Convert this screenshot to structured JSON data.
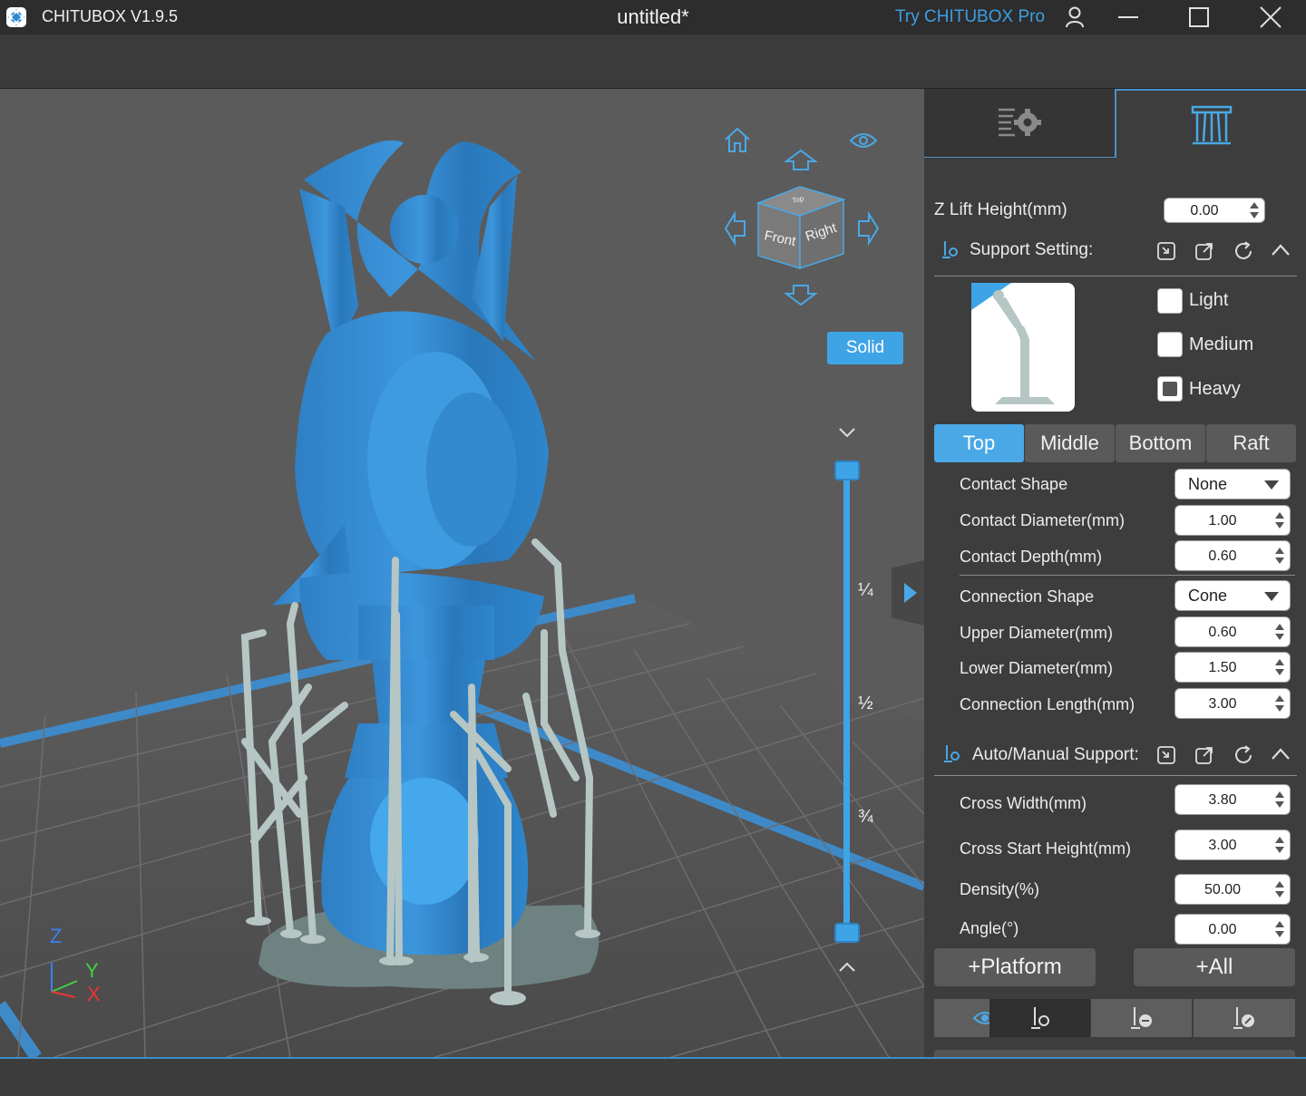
{
  "titlebar": {
    "app_name": "CHITUBOX V1.9.5",
    "document_title": "untitled*",
    "pro_link": "Try CHITUBOX Pro"
  },
  "viewport": {
    "cube_faces": {
      "front": "Front",
      "right": "Right",
      "top": "Top"
    },
    "render_mode": "Solid",
    "slider_marks": [
      "¼",
      "½",
      "¾"
    ],
    "axes": {
      "z": "Z",
      "y": "Y",
      "x": "X"
    }
  },
  "panel": {
    "z_lift_label": "Z Lift Height(mm)",
    "z_lift_value": "0.00",
    "support_setting": {
      "title": "Support Setting:",
      "presets": [
        {
          "label": "Light",
          "checked": false
        },
        {
          "label": "Medium",
          "checked": false
        },
        {
          "label": "Heavy",
          "checked": true
        }
      ]
    },
    "tabs": [
      {
        "label": "Top",
        "active": true
      },
      {
        "label": "Middle",
        "active": false
      },
      {
        "label": "Bottom",
        "active": false
      },
      {
        "label": "Raft",
        "active": false
      }
    ],
    "contact": {
      "shape_label": "Contact Shape",
      "shape_value": "None",
      "diameter_label": "Contact Diameter(mm)",
      "diameter_value": "1.00",
      "depth_label": "Contact Depth(mm)",
      "depth_value": "0.60"
    },
    "connection": {
      "shape_label": "Connection Shape",
      "shape_value": "Cone",
      "upper_label": "Upper Diameter(mm)",
      "upper_value": "0.60",
      "lower_label": "Lower Diameter(mm)",
      "lower_value": "1.50",
      "length_label": "Connection Length(mm)",
      "length_value": "3.00"
    },
    "auto_manual": {
      "title": "Auto/Manual Support:",
      "cross_width_label": "Cross Width(mm)",
      "cross_width_value": "3.80",
      "cross_start_label": "Cross Start Height(mm)",
      "cross_start_value": "3.00",
      "density_label": "Density(%)",
      "density_value": "50.00",
      "angle_label": "Angle(°)",
      "angle_value": "0.00"
    },
    "platform_button": "+Platform",
    "all_button": "+All"
  },
  "colors": {
    "accent": "#3fa4e6",
    "model": "#3a8fd0",
    "support": "#b8c8c8"
  }
}
